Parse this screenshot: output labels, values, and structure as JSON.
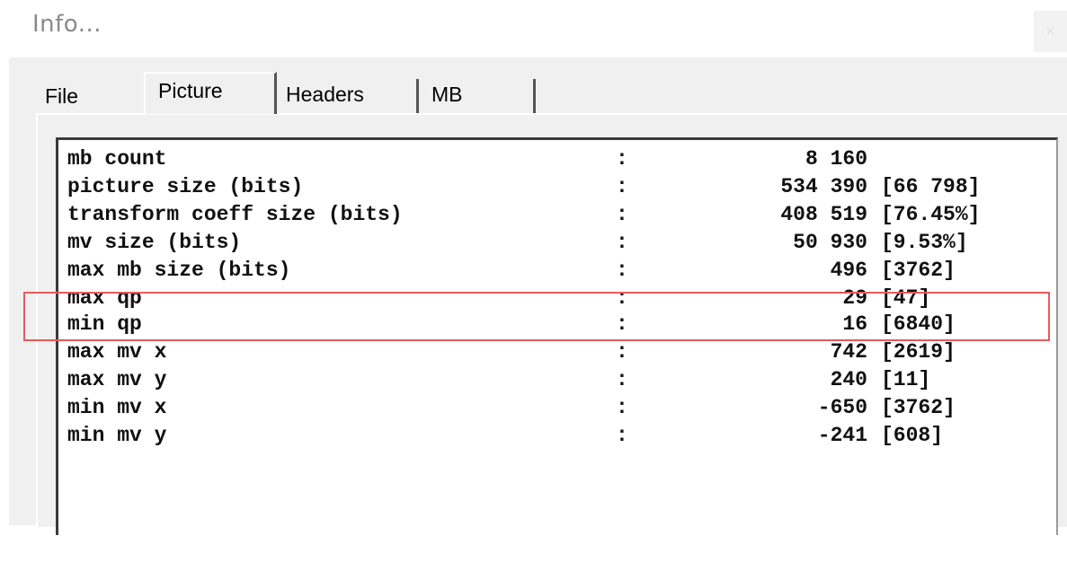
{
  "window": {
    "title": "Info...",
    "close_label": "×"
  },
  "tabs": [
    {
      "label": "File",
      "active": false
    },
    {
      "label": "Picture",
      "active": true
    },
    {
      "label": "Headers",
      "active": false
    },
    {
      "label": "MB",
      "active": false
    }
  ],
  "stats": [
    {
      "name": "mb count",
      "colon": ":",
      "value": "8 160",
      "extra": ""
    },
    {
      "name": "picture size (bits)",
      "colon": ":",
      "value": "534 390",
      "extra": "[66 798]"
    },
    {
      "name": "transform coeff size (bits)",
      "colon": ":",
      "value": "408 519",
      "extra": "[76.45%]"
    },
    {
      "name": "mv size (bits)",
      "colon": ":",
      "value": "50 930",
      "extra": "[9.53%]"
    },
    {
      "name": "max mb size (bits)",
      "colon": ":",
      "value": "496",
      "extra": "[3762]"
    },
    {
      "name": "max qp",
      "colon": ":",
      "value": "29",
      "extra": "[47]"
    },
    {
      "name": "min qp",
      "colon": ":",
      "value": "16",
      "extra": "[6840]"
    },
    {
      "name": "max mv x",
      "colon": ":",
      "value": "742",
      "extra": "[2619]"
    },
    {
      "name": "max mv y",
      "colon": ":",
      "value": "240",
      "extra": "[11]"
    },
    {
      "name": "min mv x",
      "colon": ":",
      "value": "-650",
      "extra": "[3762]"
    },
    {
      "name": "min mv y",
      "colon": ":",
      "value": "-241",
      "extra": "[608]"
    }
  ],
  "annotation": {
    "color": "#e8595c"
  }
}
